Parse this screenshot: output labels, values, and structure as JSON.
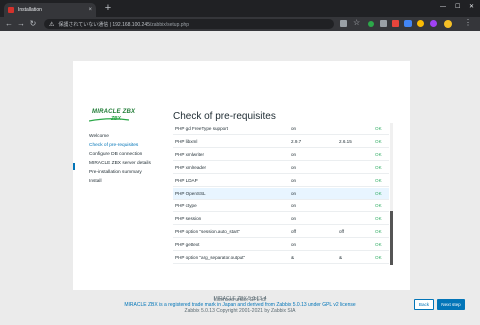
{
  "browser": {
    "tab_title": "Installation",
    "tab_close": "×",
    "new_tab": "+",
    "window_controls": [
      "—",
      "☐",
      "✕"
    ],
    "nav": {
      "back": "←",
      "forward": "→",
      "reload": "↻"
    },
    "address": {
      "security_label": "保護されていない通信",
      "host": "192.168.100.245",
      "path": "/zabbix/setup.php"
    }
  },
  "product": {
    "logo_main": "MIRACLE ZBX",
    "logo_sub": "ZBX"
  },
  "setup": {
    "heading": "Check of pre-requisites",
    "steps": [
      "Welcome",
      "Check of pre-requisites",
      "Configure DB connection",
      "MIRACLE ZBX server details",
      "Pre-installation summary",
      "Install"
    ],
    "active_step": 1,
    "rows": [
      {
        "name": "PHP gd FreeType support",
        "current": "on",
        "required": "",
        "status": "OK"
      },
      {
        "name": "PHP libxml",
        "current": "2.9.7",
        "required": "2.6.15",
        "status": "OK"
      },
      {
        "name": "PHP xmlwriter",
        "current": "on",
        "required": "",
        "status": "OK"
      },
      {
        "name": "PHP xmlreader",
        "current": "on",
        "required": "",
        "status": "OK"
      },
      {
        "name": "PHP LDAP",
        "current": "on",
        "required": "",
        "status": "OK"
      },
      {
        "name": "PHP OpenSSL",
        "current": "on",
        "required": "",
        "status": "OK"
      },
      {
        "name": "PHP ctype",
        "current": "on",
        "required": "",
        "status": "OK"
      },
      {
        "name": "PHP session",
        "current": "on",
        "required": "",
        "status": "OK"
      },
      {
        "name": "PHP option \"session.auto_start\"",
        "current": "off",
        "required": "off",
        "status": "OK"
      },
      {
        "name": "PHP gettext",
        "current": "on",
        "required": "",
        "status": "OK"
      },
      {
        "name": "PHP option \"arg_separator.output\"",
        "current": "&",
        "required": "&",
        "status": "OK"
      }
    ],
    "highlighted_row": 5,
    "back_label": "Back",
    "next_label": "Next step"
  },
  "footer": {
    "license": "Licensed under GPL v2",
    "version": "MIRACLE ZBX 5.0.13-4",
    "trademark": "MIRACLE ZBX is a registered trade mark in Japan and derived from Zabbix 5.0.13 under GPL v2 license",
    "copyright": "Zabbix 5.0.13 Copyright 2001-2021 by Zabbix SIA"
  },
  "colors": {
    "accent": "#0275b8",
    "ok": "#34af67",
    "logo_green": "#1e7b34"
  },
  "icons": {
    "favicon": "zabbix-favicon-icon",
    "warning": "warning-triangle-icon",
    "extensions": [
      "translate-icon",
      "star-icon",
      "green-dot-icon",
      "extension-icon",
      "mail-icon",
      "chat-icon",
      "profile-avatar-icon",
      "menu-icon"
    ]
  }
}
